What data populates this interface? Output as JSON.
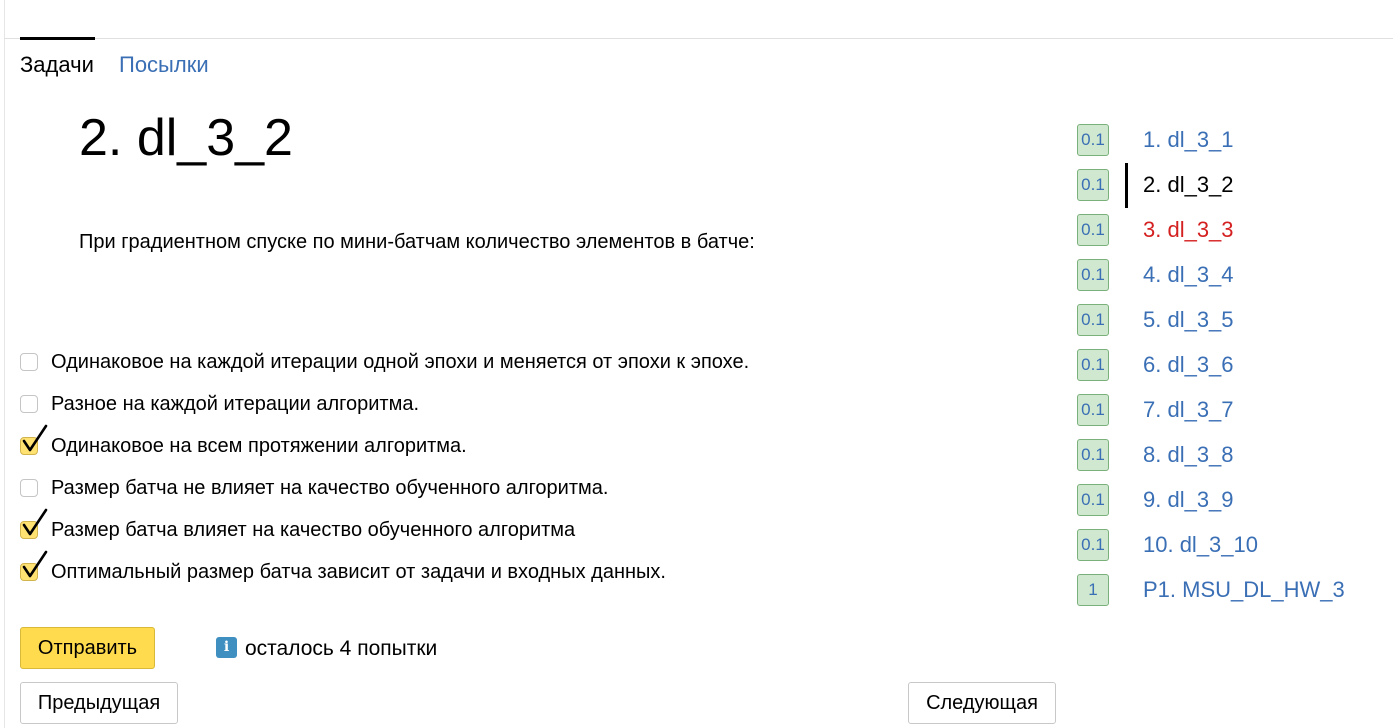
{
  "tabs": {
    "problems": "Задачи",
    "submissions": "Посылки"
  },
  "problem": {
    "title": "2. dl_3_2",
    "statement": "При градиентном спуске по мини-батчам количество элементов в батче:"
  },
  "options": [
    {
      "label": "Одинаковое на каждой итерации одной эпохи и меняется от эпохи к эпохе.",
      "checked": false
    },
    {
      "label": "Разное на каждой итерации алгоритма.",
      "checked": false
    },
    {
      "label": "Одинаковое на всем протяжении алгоритма.",
      "checked": true
    },
    {
      "label": "Размер батча не влияет на качество обученного алгоритма.",
      "checked": false
    },
    {
      "label": "Размер батча влияет на качество обученного алгоритма",
      "checked": true
    },
    {
      "label": "Оптимальный размер батча зависит от задачи и входных данных.",
      "checked": true
    }
  ],
  "buttons": {
    "submit": "Отправить",
    "prev": "Предыдущая",
    "next": "Следующая"
  },
  "attempts": {
    "icon": "info-icon",
    "icon_glyph": "i",
    "text": "осталось 4 попытки"
  },
  "colors": {
    "link": "#3a6fb5",
    "error": "#d42020",
    "accent": "#ffdb4d",
    "score_bg": "#cfe8cf"
  },
  "sidebar": [
    {
      "score": "0.1",
      "label": "1. dl_3_1",
      "state": "link"
    },
    {
      "score": "0.1",
      "label": "2. dl_3_2",
      "state": "current"
    },
    {
      "score": "0.1",
      "label": "3. dl_3_3",
      "state": "error"
    },
    {
      "score": "0.1",
      "label": "4. dl_3_4",
      "state": "link"
    },
    {
      "score": "0.1",
      "label": "5. dl_3_5",
      "state": "link"
    },
    {
      "score": "0.1",
      "label": "6. dl_3_6",
      "state": "link"
    },
    {
      "score": "0.1",
      "label": "7. dl_3_7",
      "state": "link"
    },
    {
      "score": "0.1",
      "label": "8. dl_3_8",
      "state": "link"
    },
    {
      "score": "0.1",
      "label": "9. dl_3_9",
      "state": "link"
    },
    {
      "score": "0.1",
      "label": "10. dl_3_10",
      "state": "link"
    },
    {
      "score": "1",
      "label": "P1. MSU_DL_HW_3",
      "state": "link"
    }
  ]
}
